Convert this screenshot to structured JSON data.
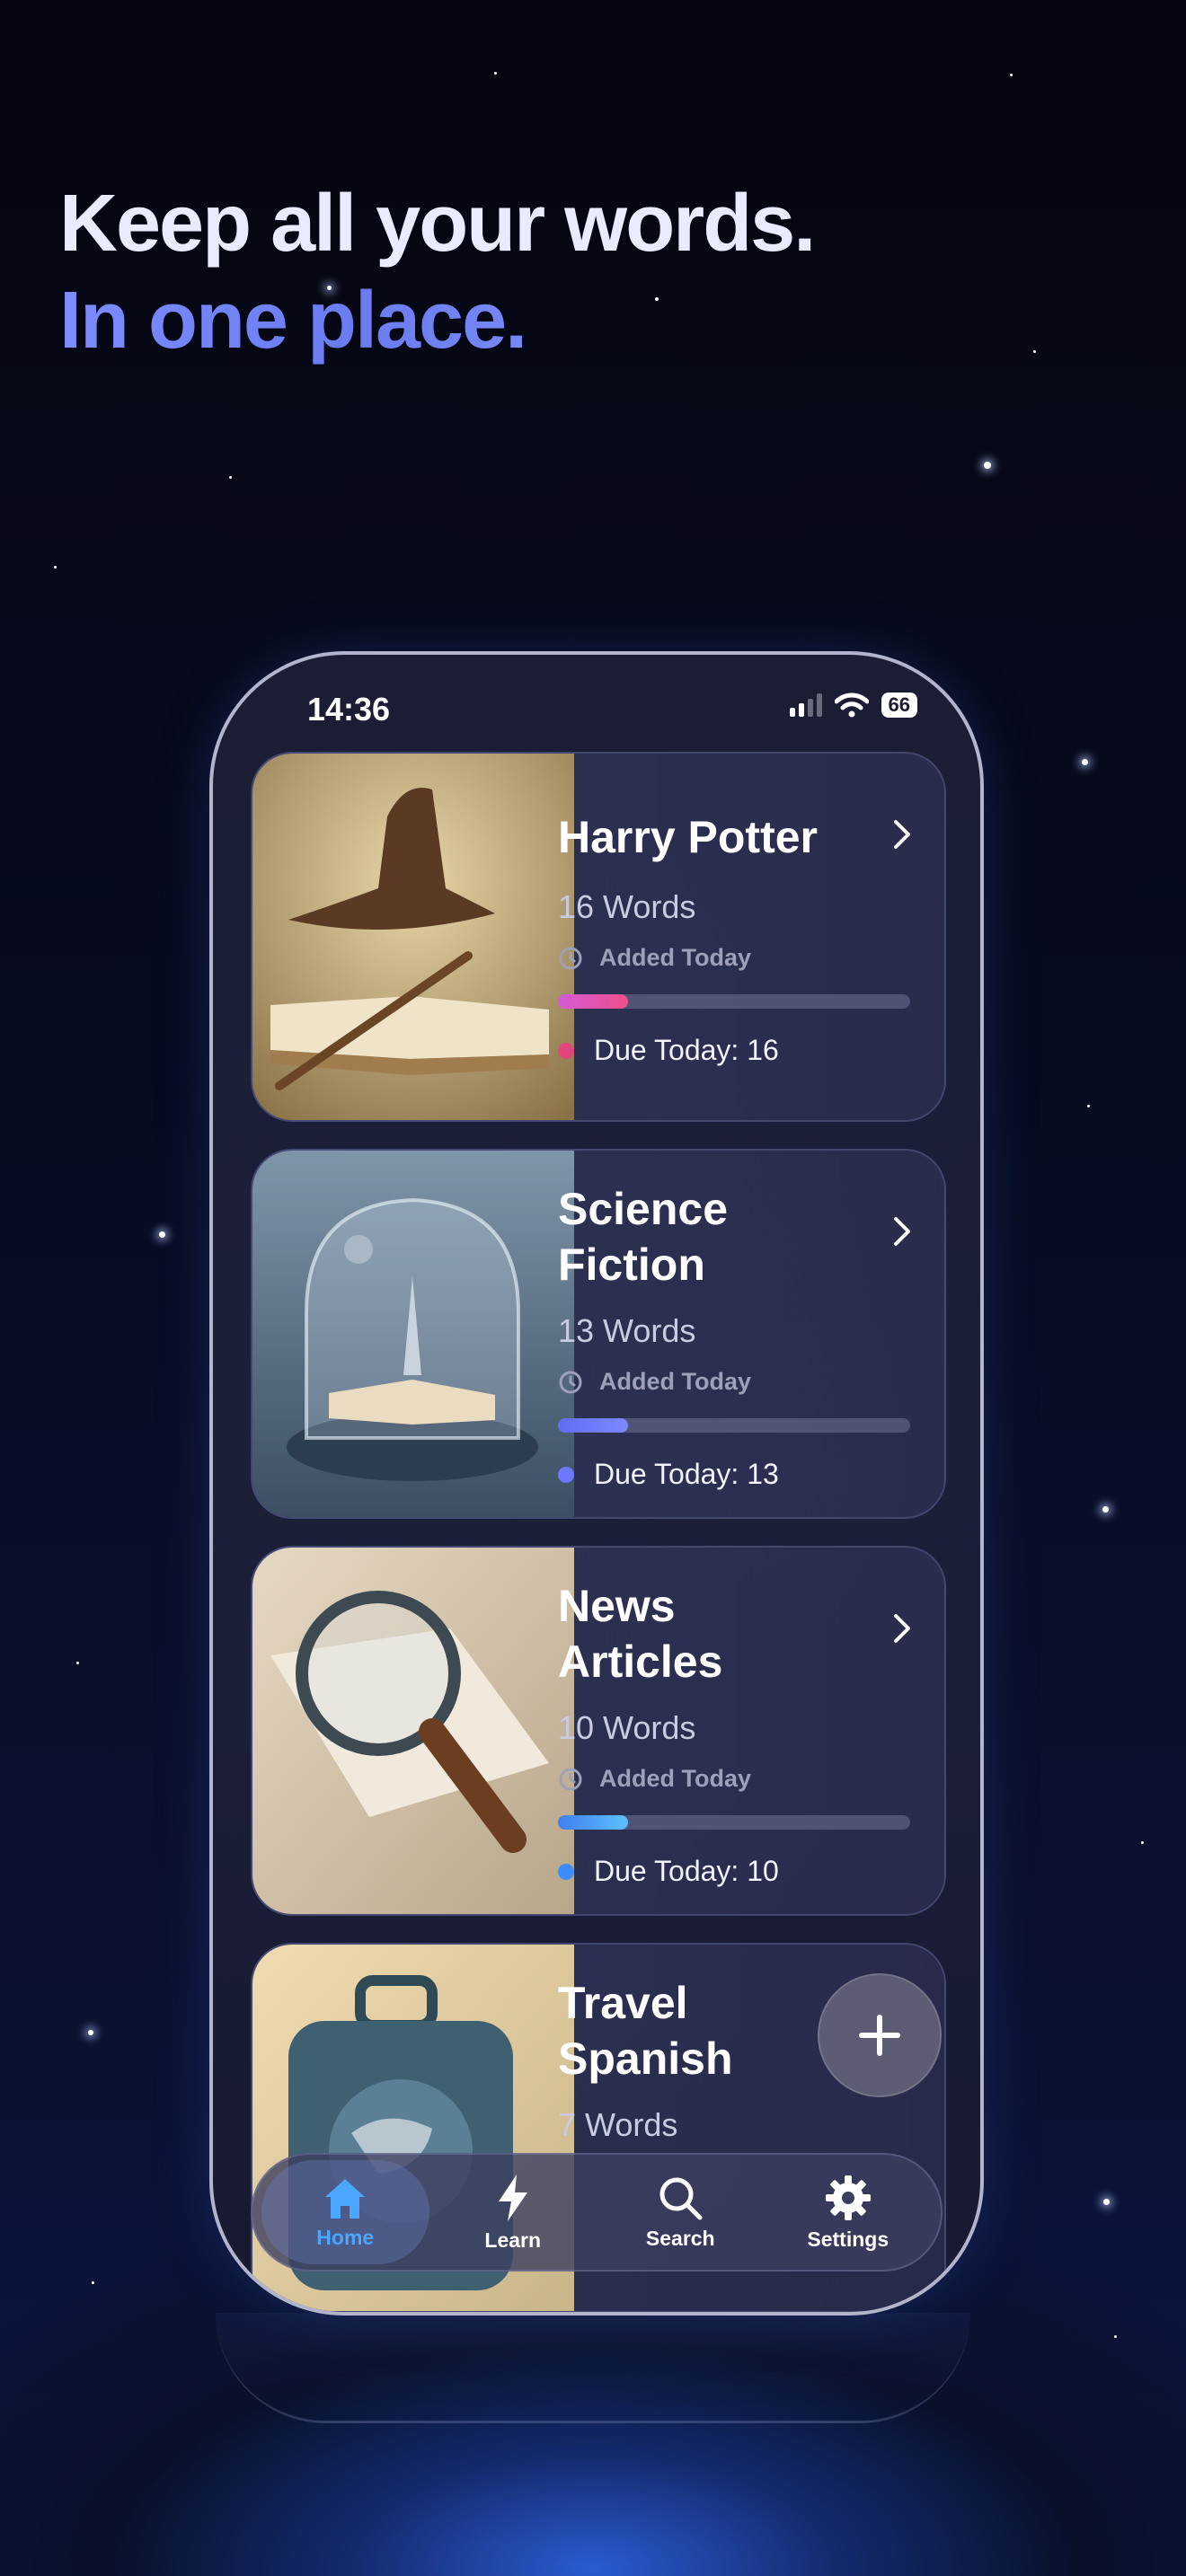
{
  "headline": {
    "line1": "Keep all your words.",
    "line2": "In one place."
  },
  "status_bar": {
    "time": "14:36",
    "battery": "66"
  },
  "collections": [
    {
      "title": "Harry Potter",
      "words": "16 Words",
      "added": "Added Today",
      "due": "Due Today: 16",
      "progress": 0.2,
      "accent": "#e0457b",
      "bar_from": "#d35ad8",
      "bar_to": "#ef4f8a"
    },
    {
      "title": "Science Fiction",
      "words": "13 Words",
      "added": "Added Today",
      "due": "Due Today: 13",
      "progress": 0.2,
      "accent": "#6b78ff",
      "bar_from": "#5f6df5",
      "bar_to": "#7d88ff"
    },
    {
      "title": "News Articles",
      "words": "10 Words",
      "added": "Added Today",
      "due": "Due Today: 10",
      "progress": 0.2,
      "accent": "#3b8dff",
      "bar_from": "#3f7ef0",
      "bar_to": "#5ec0ff"
    },
    {
      "title": "Travel Spanish",
      "words": "7 Words"
    }
  ],
  "tabs": [
    {
      "label": "Home",
      "icon": "house-icon",
      "active": true
    },
    {
      "label": "Learn",
      "icon": "lightning-icon",
      "active": false
    },
    {
      "label": "Search",
      "icon": "search-icon",
      "active": false
    },
    {
      "label": "Settings",
      "icon": "gear-icon",
      "active": false
    }
  ],
  "fab_icon": "plus-icon"
}
